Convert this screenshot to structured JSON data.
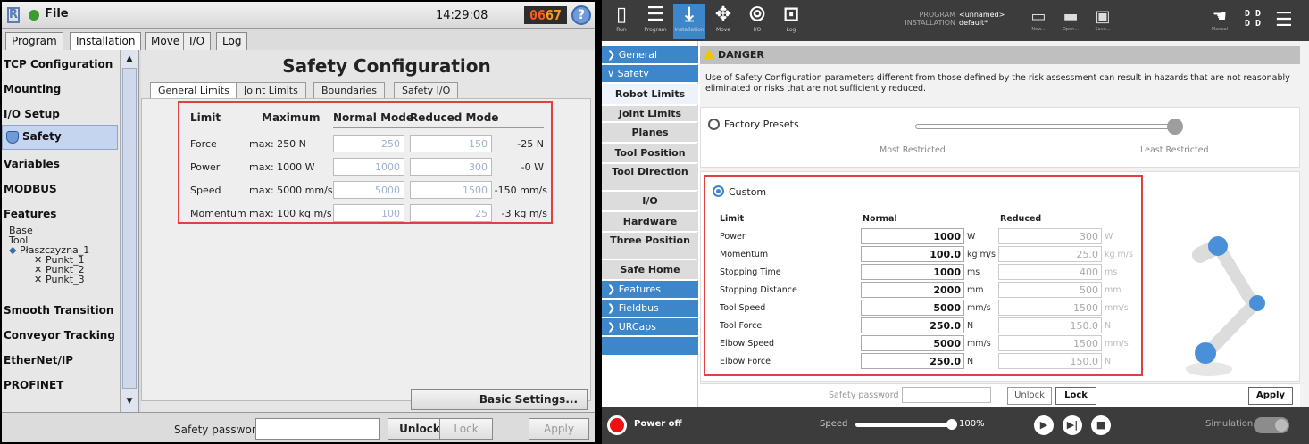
{
  "left": {
    "logo": "R",
    "file_label": "File",
    "time": "14:29:08",
    "code": [
      "06",
      "67"
    ],
    "help": "?",
    "tabs": [
      "Program",
      "Installation",
      "Move",
      "I/O",
      "Log"
    ],
    "sidebar": [
      "TCP Configuration",
      "Mounting",
      "I/O Setup",
      "Safety",
      "Variables",
      "MODBUS",
      "Features",
      "Smooth Transition",
      "Conveyor Tracking",
      "EtherNet/IP",
      "PROFINET"
    ],
    "tree": [
      "Base",
      "Tool",
      "Płaszczyzna_1",
      "Punkt_1",
      "Punkt_2",
      "Punkt_3"
    ],
    "heading": "Safety Configuration",
    "subtabs": [
      "General Limits",
      "Joint Limits",
      "Boundaries",
      "Safety I/O"
    ],
    "headers": [
      "Limit",
      "Maximum",
      "Normal Mode",
      "Reduced Mode"
    ],
    "rows": [
      {
        "limit": "Force",
        "max": "max: 250 N",
        "normal": "250",
        "reduced": "150",
        "delta": "-25 N"
      },
      {
        "limit": "Power",
        "max": "max: 1000 W",
        "normal": "1000",
        "reduced": "300",
        "delta": "-0 W"
      },
      {
        "limit": "Speed",
        "max": "max: 5000 mm/s",
        "normal": "5000",
        "reduced": "1500",
        "delta": "-150 mm/s"
      },
      {
        "limit": "Momentum",
        "max": "max: 100 kg m/s",
        "normal": "100",
        "reduced": "25",
        "delta": "-3 kg m/s"
      }
    ],
    "basic_settings": "Basic Settings...",
    "password_label": "Safety password",
    "unlock": "Unlock",
    "lock": "Lock",
    "apply": "Apply"
  },
  "right": {
    "topnav": [
      "Run",
      "Program",
      "Installation",
      "Move",
      "I/O",
      "Log"
    ],
    "program_label": "PROGRAM",
    "program_value": "<unnamed>",
    "installation_label": "INSTALLATION",
    "installation_value": "default*",
    "file_buttons": [
      "New...",
      "Open...",
      "Save..."
    ],
    "manual": "Manual",
    "dd": "D D\nD D",
    "sections": [
      "General",
      "Safety",
      "Features",
      "Fieldbus",
      "URCaps"
    ],
    "safety_items": [
      "Robot Limits",
      "Joint Limits",
      "Planes",
      "Tool Position",
      "Tool Direction",
      "I/O",
      "Hardware",
      "Three Position",
      "Safe Home"
    ],
    "danger_title": "DANGER",
    "danger_text": "Use of Safety Configuration parameters different from those defined by the risk assessment can result in hazards that are not reasonably eliminated or risks that are not sufficiently reduced.",
    "factory_presets": "Factory Presets",
    "most_restricted": "Most Restricted",
    "least_restricted": "Least Restricted",
    "custom": "Custom",
    "headers": [
      "Limit",
      "Normal",
      "Reduced"
    ],
    "rows": [
      {
        "limit": "Power",
        "normal": "1000",
        "nunit": "W",
        "reduced": "300",
        "runit": "W"
      },
      {
        "limit": "Momentum",
        "normal": "100.0",
        "nunit": "kg m/s",
        "reduced": "25.0",
        "runit": "kg m/s"
      },
      {
        "limit": "Stopping Time",
        "normal": "1000",
        "nunit": "ms",
        "reduced": "400",
        "runit": "ms"
      },
      {
        "limit": "Stopping Distance",
        "normal": "2000",
        "nunit": "mm",
        "reduced": "500",
        "runit": "mm"
      },
      {
        "limit": "Tool Speed",
        "normal": "5000",
        "nunit": "mm/s",
        "reduced": "1500",
        "runit": "mm/s"
      },
      {
        "limit": "Tool Force",
        "normal": "250.0",
        "nunit": "N",
        "reduced": "150.0",
        "runit": "N"
      },
      {
        "limit": "Elbow Speed",
        "normal": "5000",
        "nunit": "mm/s",
        "reduced": "1500",
        "runit": "mm/s"
      },
      {
        "limit": "Elbow Force",
        "normal": "250.0",
        "nunit": "N",
        "reduced": "150.0",
        "runit": "N"
      }
    ],
    "password_label": "Safety password",
    "unlock": "Unlock",
    "lock": "Lock",
    "apply": "Apply",
    "power_off": "Power off",
    "speed_label": "Speed",
    "speed_value": "100%",
    "simulation": "Simulation"
  },
  "colors": {
    "accent": "#3c86c9",
    "highlight_box": "#e04040",
    "danger": "#f5c400"
  }
}
